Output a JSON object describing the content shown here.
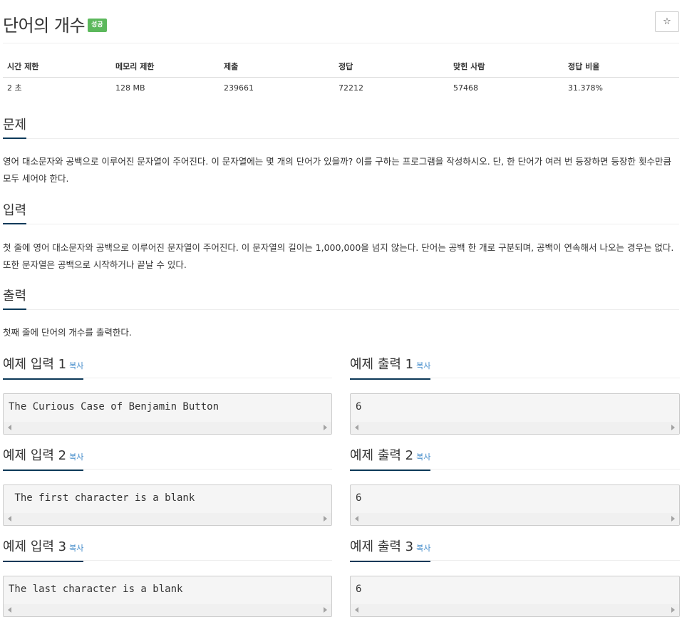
{
  "problem": {
    "title": "단어의 개수",
    "status_badge": "성공",
    "star_glyph": "☆"
  },
  "info_table": {
    "headers": [
      "시간 제한",
      "메모리 제한",
      "제출",
      "정답",
      "맞힌 사람",
      "정답 비율"
    ],
    "values": [
      "2 초",
      "128 MB",
      "239661",
      "72212",
      "57468",
      "31.378%"
    ]
  },
  "sections": {
    "description": {
      "heading": "문제",
      "text": "영어 대소문자와 공백으로 이루어진 문자열이 주어진다. 이 문자열에는 몇 개의 단어가 있을까? 이를 구하는 프로그램을 작성하시오. 단, 한 단어가 여러 번 등장하면 등장한 횟수만큼 모두 세어야 한다."
    },
    "input": {
      "heading": "입력",
      "text": "첫 줄에 영어 대소문자와 공백으로 이루어진 문자열이 주어진다. 이 문자열의 길이는 1,000,000을 넘지 않는다. 단어는 공백 한 개로 구분되며, 공백이 연속해서 나오는 경우는 없다. 또한 문자열은 공백으로 시작하거나 끝날 수 있다."
    },
    "output": {
      "heading": "출력",
      "text": "첫째 줄에 단어의 개수를 출력한다."
    }
  },
  "copy_label": "복사",
  "samples": [
    {
      "input_heading": "예제 입력 1",
      "input": "The Curious Case of Benjamin Button",
      "output_heading": "예제 출력 1",
      "output": "6"
    },
    {
      "input_heading": "예제 입력 2",
      "input": " The first character is a blank",
      "output_heading": "예제 출력 2",
      "output": "6"
    },
    {
      "input_heading": "예제 입력 3",
      "input": "The last character is a blank",
      "output_heading": "예제 출력 3",
      "output": "6"
    }
  ]
}
